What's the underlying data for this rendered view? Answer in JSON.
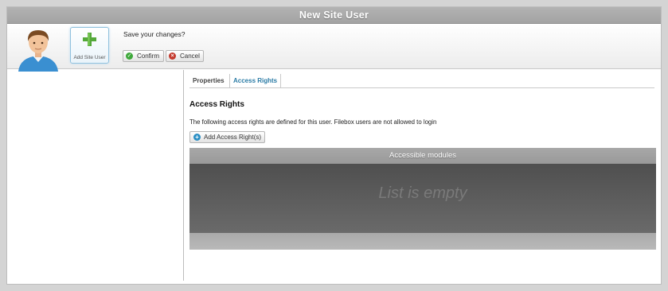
{
  "window": {
    "title": "New Site User"
  },
  "header": {
    "add_site_user_label": "Add Site User",
    "save_prompt": "Save your changes?",
    "confirm_label": "Confirm",
    "cancel_label": "Cancel"
  },
  "tabs": [
    {
      "label": "Properties",
      "active": false
    },
    {
      "label": "Access Rights",
      "active": true
    }
  ],
  "section": {
    "title": "Access Rights",
    "description": "The following access rights are defined for this user. Filebox users are not allowed to login",
    "add_button_label": "Add Access Right(s)"
  },
  "grid": {
    "header": "Accessible modules",
    "empty_text": "List is empty"
  },
  "icons": {
    "avatar": "user-avatar-icon",
    "add": "green-plus-icon",
    "confirm": "check-circle-icon",
    "cancel": "x-circle-icon",
    "add_access": "plus-circle-icon"
  },
  "colors": {
    "accent_tab": "#2c7ca6",
    "confirm_green": "#3ea83a",
    "cancel_red": "#c43a2e",
    "add_blue": "#2b8fc4"
  }
}
